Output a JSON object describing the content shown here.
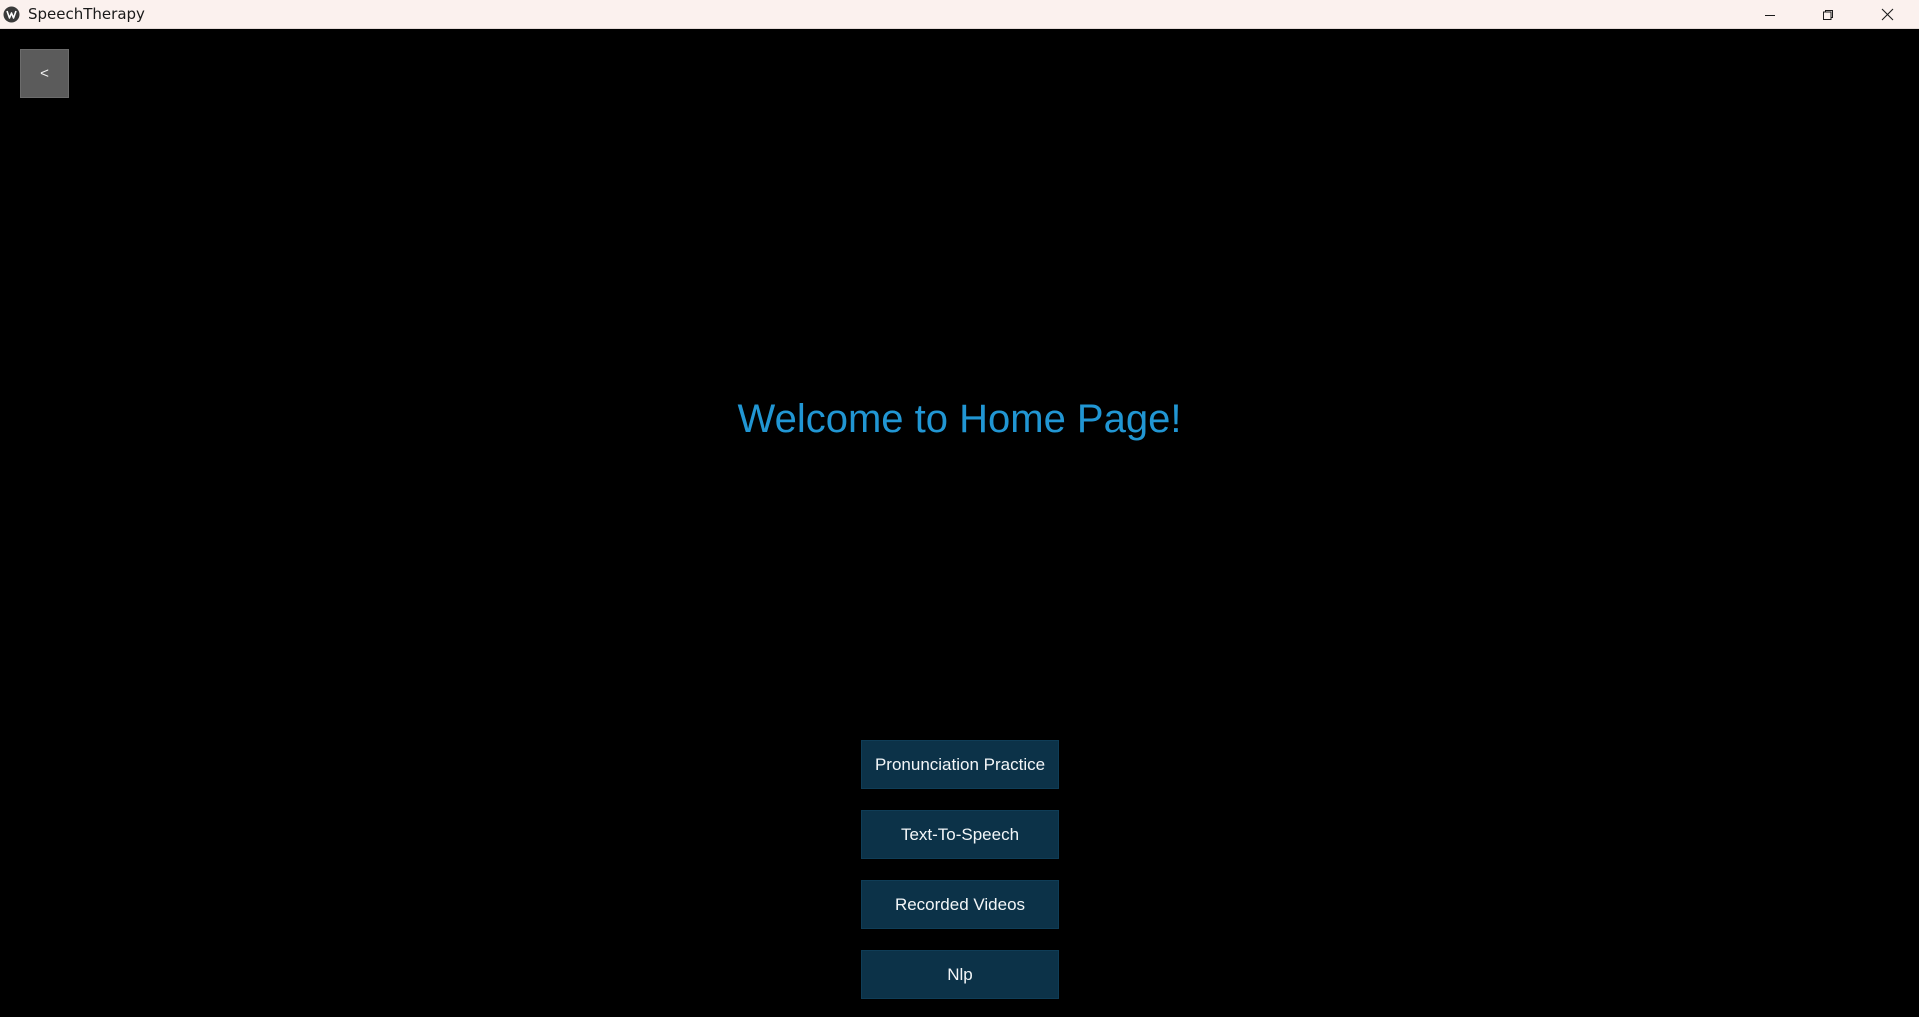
{
  "window": {
    "title": "SpeechTherapy",
    "controls": {
      "minimize_icon": "minimize-icon",
      "maximize_icon": "restore-icon",
      "close_icon": "close-icon"
    }
  },
  "nav": {
    "back_label": "<"
  },
  "main": {
    "heading": "Welcome to Home Page!",
    "heading_color": "#2196d3",
    "menu": [
      {
        "label": "Pronunciation Practice"
      },
      {
        "label": "Text-To-Speech"
      },
      {
        "label": "Recorded Videos"
      },
      {
        "label": "Nlp"
      }
    ]
  },
  "colors": {
    "background": "#000000",
    "titlebar": "#fbf1ee",
    "button_bg": "#0c3248",
    "back_button_bg": "#5b5b5b"
  }
}
